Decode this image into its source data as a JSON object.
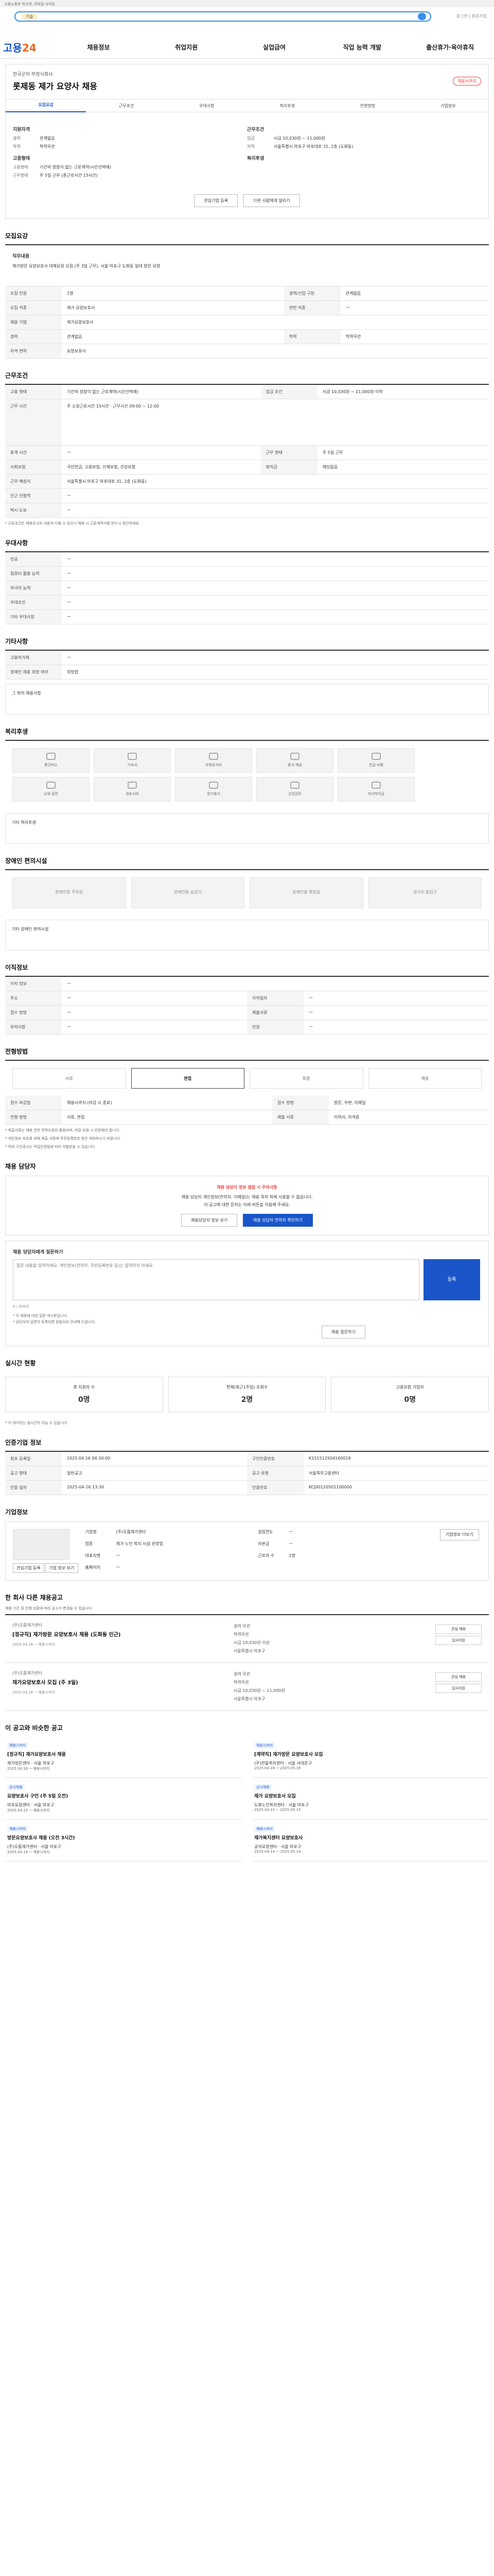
{
  "topbar": {
    "text": "고용노동부 워크넷, 모바일 사이트"
  },
  "search": {
    "tag": "기술",
    "right_text": "로그인 | 회원가입"
  },
  "gnb": {
    "logo_a": "고용",
    "logo_b": "24",
    "items": [
      "채용정보",
      "취업지원",
      "실업급여",
      "직업 능력 개발",
      "출산휴가·육아휴직"
    ]
  },
  "job": {
    "company": "한국군자 부정식회사",
    "title": "롯제동 제가 요양사 채용",
    "badge": "채용시까지",
    "tabs": [
      "모집요강",
      "근무조건",
      "우대사항",
      "복리후생",
      "전형방법",
      "기업정보"
    ],
    "summary_left_h": "지원자격",
    "summary_right_h": "근무조건",
    "left_rows": [
      {
        "k": "경력",
        "v": "관계없음"
      },
      {
        "k": "학력",
        "v": "학력무관"
      }
    ],
    "left_h2": "고용형태",
    "left_rows2": [
      {
        "k": "고용형태",
        "v": "기간의 정함이 없는 근로계약(시간선택제)"
      },
      {
        "k": "근무형태",
        "v": "주 5일 근무 (총근로시간 15시간)"
      }
    ],
    "right_rows": [
      {
        "k": "임금",
        "v": "시급 10,030원 ~ 11,000원"
      },
      {
        "k": "지역",
        "v": "서울특별시 마포구 마포대로 31, 2층 (도화동)"
      }
    ],
    "right_h2": "복리후생",
    "btn_apply": "관심기업 등록",
    "btn_share": "다른 사람에게 알리기"
  },
  "sections": {
    "recruit": "모집요강",
    "conditions": "근무조건",
    "preferred": "우대사항",
    "other": "기타사항",
    "welfare": "복리후생",
    "disability": "장애인 편의시설",
    "worktime": "이직정보",
    "process": "전형방법",
    "contact": "채용 담당자",
    "realtime": "실시간 현황",
    "info": "인증기업 정보",
    "company": "기업정보",
    "same": "한 회사 다른 채용공고",
    "similar": "이 공고와 비슷한 공고"
  },
  "recruit": {
    "desc_h": "직무내용",
    "desc": "재가방문 요양보호사 대체요원 모집 (주 3일 근무), 서울 마포구 도화동 일대 방문 요양",
    "rows": [
      {
        "k": "모집 인원",
        "v": "1명",
        "k2": "경력/신입 구분",
        "v2": "관계없음"
      },
      {
        "k": "모집 직종",
        "v": "재가 요양보호사",
        "k2": "관련 직종",
        "v2": "—"
      },
      {
        "k": "채용 기업",
        "v": "재가요양보호사",
        "k2": "",
        "v2": ""
      },
      {
        "k": "경력",
        "v": "관계없음",
        "k2": "학력",
        "v2": "학력무관"
      },
      {
        "k": "자격 면허",
        "v": "요양보호사",
        "k2": "",
        "v2": ""
      }
    ]
  },
  "conditions": {
    "rows": [
      {
        "k": "고용 형태",
        "v": "기간의 정함이 없는 근로계약(시간선택제)",
        "k2": "임금 조건",
        "v2": "시급 10,030원 ~ 11,000원 이하"
      },
      {
        "k": "근무 시간",
        "v": "주 소정근로시간 15시간 · 근무시간 09:00 ~ 12:00",
        "k2": "",
        "v2": ""
      },
      {
        "k": "휴게 시간",
        "v": "—",
        "k2": "근무 형태",
        "v2": "주 5일 근무"
      },
      {
        "k": "사회보험",
        "v": "국민연금, 고용보험, 산재보험, 건강보험",
        "k2": "퇴직금",
        "v2": "해당없음"
      },
      {
        "k": "근무 예정지",
        "v": "서울특별시 마포구 마포대로 31, 2층 (도화동)",
        "k2": "",
        "v2": ""
      },
      {
        "k": "인근 전철역",
        "v": "—",
        "k2": "",
        "v2": ""
      },
      {
        "k": "택시·도보",
        "v": "—",
        "k2": "",
        "v2": ""
      }
    ],
    "note": "* 근로조건은 채용공고의 내용과 다를 수 있으니 채용 시 근로계약서를 반드시 확인하세요."
  },
  "preferred": {
    "rows": [
      {
        "k": "전공",
        "v": "—"
      },
      {
        "k": "컴퓨터 활용 능력",
        "v": "—"
      },
      {
        "k": "외국어 능력",
        "v": "—"
      },
      {
        "k": "우대조건",
        "v": "—"
      },
      {
        "k": "기타 우대사항",
        "v": "—"
      }
    ]
  },
  "other": {
    "rows": [
      {
        "k": "고용허가제",
        "v": "—"
      },
      {
        "k": "장애인 채용 희망 여부",
        "v": "희망함"
      }
    ],
    "box": "그 밖의 채용사항"
  },
  "welfare": {
    "items": [
      "통근버스",
      "기숙사",
      "차량유지비",
      "중식 제공",
      "연금·보험",
      "교육·훈련",
      "경조사비",
      "정기휴가",
      "건강검진",
      "자녀학자금"
    ],
    "box": "기타 복리후생"
  },
  "disability": {
    "items": [
      "장애인용 주차장",
      "장애인용 승강기",
      "장애인용 화장실",
      "경사로·출입구"
    ],
    "box": "기타 장애인 편의시설"
  },
  "worktime": {
    "rows": [
      {
        "k": "이직 정보",
        "v": "—",
        "k2": "",
        "v2": ""
      },
      {
        "k": "주소",
        "v": "—",
        "k2": "이직일자",
        "v2": "—"
      },
      {
        "k": "접수 방법",
        "v": "—",
        "k2": "제출서류",
        "v2": "—"
      },
      {
        "k": "유의사항",
        "v": "—",
        "k2": "인원",
        "v2": "—"
      }
    ]
  },
  "process": {
    "steps": [
      "서류",
      "면접",
      "최종",
      "채용"
    ],
    "rows": [
      {
        "k": "접수 마감일",
        "v": "채용시까지 (마감 시 종료)",
        "k2": "접수 방법",
        "v2": "방문, 우편, 이메일"
      },
      {
        "k": "전형 방법",
        "v": "서류, 면접",
        "k2": "제출 서류",
        "v2": "이력서, 자격증"
      }
    ],
    "notes": [
      "* 제출서류는 채용 관련 목적으로만 활용되며, 반환 요청 시 반환해야 합니다.",
      "* 개인정보 보호를 위해 제출 서류에 주민등록번호 등은 제외하시기 바랍니다.",
      "* 허위 구인광고는 직업안정법에 따라 처벌받을 수 있습니다."
    ]
  },
  "contact": {
    "warn": "채용 담당자 정보 열람 시 주의사항",
    "msg1": "채용 담당자 개인정보(연락처, 이메일)는 채용 목적 외에 사용할 수 없습니다.",
    "msg2": "이 공고에 대한 문의는 아래 버튼을 이용해 주세요.",
    "btn1": "채용담당자 정보 보기",
    "btn2": "채용 담당자 연락처 확인하기"
  },
  "qa": {
    "label": "채용 담당자에게 질문하기",
    "placeholder": "질문 내용을 입력하세요. 개인정보(연락처, 주민등록번호 등)는 입력하지 마세요.",
    "send": "등록",
    "count": "0 / 500자",
    "notes": [
      "* 이 채용에 대한 질문 게시판입니다.",
      "* 담당자의 답변이 등록되면 알림으로 안내해 드립니다."
    ],
    "btn": "채용 질문하기"
  },
  "realtime": {
    "more": "더보기",
    "stats": [
      {
        "k": "총 지원자 수",
        "v": "0명"
      },
      {
        "k": "현재(최근1주일) 조회수",
        "v": "2명"
      },
      {
        "k": "고용보험 가입자",
        "v": "0명"
      }
    ],
    "note": "* 이 데이터는 실시간이 아닐 수 있습니다."
  },
  "info": {
    "btn": "기업정보 상세보기",
    "rows": [
      {
        "k": "최초 등록일",
        "v": "2025.04.16 04:30:00",
        "k2": "구인인증번호",
        "v2": "K151512504160018"
      },
      {
        "k": "공고 형태",
        "v": "일반공고",
        "k2": "공고 유형",
        "v2": "서울북부고용센터"
      },
      {
        "k": "인증 일자",
        "v": "2025-04-16 13:30",
        "k2": "인증번호",
        "v2": "KCJ00120501100000"
      }
    ]
  },
  "company": {
    "btn1": "관심기업 등록",
    "btn2": "기업 정보 보기",
    "rows": [
      {
        "k": "기업명",
        "v": "(주)오름재가센터",
        "k2": "설립연도",
        "v2": "—"
      },
      {
        "k": "업종",
        "v": "재가 노인 복지 시설 운영업",
        "k2": "자본금",
        "v2": "—"
      },
      {
        "k": "대표자명",
        "v": "—",
        "k2": "근로자 수",
        "v2": "1명"
      },
      {
        "k": "홈페이지",
        "v": "—",
        "k2": "",
        "v2": ""
      }
    ],
    "more": "기업정보 더보기"
  },
  "same": {
    "note": "채용 기간 및 진행 상황에 따라 공고가 변경될 수 있습니다.",
    "items": [
      {
        "co": "(주)오름재가센터",
        "title": "[정규직] 재가방문 요양보호사 채용 (도화동 인근)",
        "date": "2025.04.16 ~ 채용시까지",
        "m1": "경력 무관",
        "m2": "학력무관",
        "m3": "시급 10,030원 이상",
        "m4": "서울특별시 마포구"
      },
      {
        "co": "(주)오름재가센터",
        "title": "재가요양보호사 모집 (주 3일)",
        "date": "2025.04.16 ~ 채용시까지",
        "m1": "경력 무관",
        "m2": "학력무관",
        "m3": "시급 10,030원 ~ 11,000원",
        "m4": "서울특별시 마포구"
      }
    ],
    "btn_a": "관심 채용",
    "btn_b": "입사지원"
  },
  "similar": {
    "items": [
      {
        "tag": "채용시까지",
        "title": "[정규직] 재가요양보호사 채용",
        "co": "재가방문센터 · 서울 마포구",
        "m": "2025.04.16 ~ 채용시까지"
      },
      {
        "tag": "채용시까지",
        "title": "[계약직] 재가방문 요양보호사 모집",
        "co": "(주)한울복지센터 · 서울 서대문구",
        "m": "2025.04.16 ~ 2025.05.16"
      },
      {
        "tag": "상시채용",
        "title": "요양보호사 구인 (주 5일 오전)",
        "co": "마포요양센터 · 서울 마포구",
        "m": "2025.04.15 ~ 채용시까지"
      },
      {
        "tag": "상시채용",
        "title": "재가 요양보호사 모집",
        "co": "도화노인복지센터 · 서울 마포구",
        "m": "2025.04.15 ~ 2025.05.15"
      },
      {
        "tag": "채용시까지",
        "title": "방문요양보호사 채용 (오전 3시간)",
        "co": "(주)오름재가센터 · 서울 마포구",
        "m": "2025.04.14 ~ 채용시까지"
      },
      {
        "tag": "채용시까지",
        "title": "재가복지센터 요양보호사",
        "co": "공덕요양센터 · 서울 마포구",
        "m": "2025.04.14 ~ 2025.05.14"
      }
    ]
  }
}
